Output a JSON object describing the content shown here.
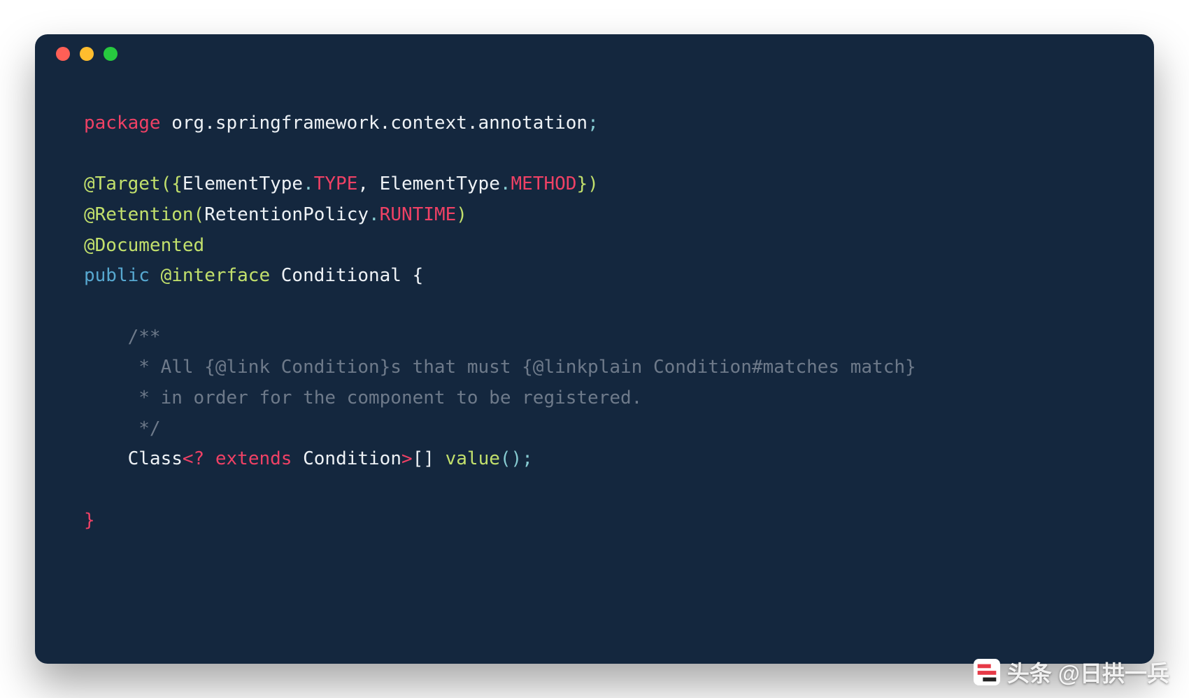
{
  "colors": {
    "window_bg": "#14273e",
    "keyword": "#ef4165",
    "annotation": "#c2e06c",
    "type": "#57a8d0",
    "comment": "#6e7a8a",
    "teal": "#86cbd1",
    "plain": "#eef2f6",
    "dot_red": "#ff5f56",
    "dot_yellow": "#ffbd2e",
    "dot_green": "#27c93f"
  },
  "code": {
    "l1_package_kw": "package",
    "l1_package_name": " org.springframework.context.annotation",
    "l1_semi": ";",
    "l3_target": "@Target",
    "l3_open": "({",
    "l3_et1": "ElementType",
    "l3_dot1": ".",
    "l3_type": "TYPE",
    "l3_comma": ", ",
    "l3_et2": "ElementType",
    "l3_dot2": ".",
    "l3_method": "METHOD",
    "l3_close": "})",
    "l4_retention": "@Retention",
    "l4_open": "(",
    "l4_rp": "RetentionPolicy",
    "l4_dot": ".",
    "l4_runtime": "RUNTIME",
    "l4_close": ")",
    "l5_documented": "@Documented",
    "l6_public": "public",
    "l6_interface": " @interface",
    "l6_name": " Conditional ",
    "l6_brace": "{",
    "l8_c1": "    /**",
    "l9_c2": "     * All {@link Condition}s that must {@linkplain Condition#matches match}",
    "l10_c3": "     * in order for the component to be registered.",
    "l11_c4": "     */",
    "l12_indent": "    ",
    "l12_class": "Class",
    "l12_gen_open": "<? ",
    "l12_extends": "extends",
    "l12_cond": " Condition",
    "l12_gen_close": ">",
    "l12_arr": "[] ",
    "l12_value": "value",
    "l12_call": "();",
    "l14_close": "}"
  },
  "watermark": {
    "text": "头条 @日拱一兵"
  }
}
